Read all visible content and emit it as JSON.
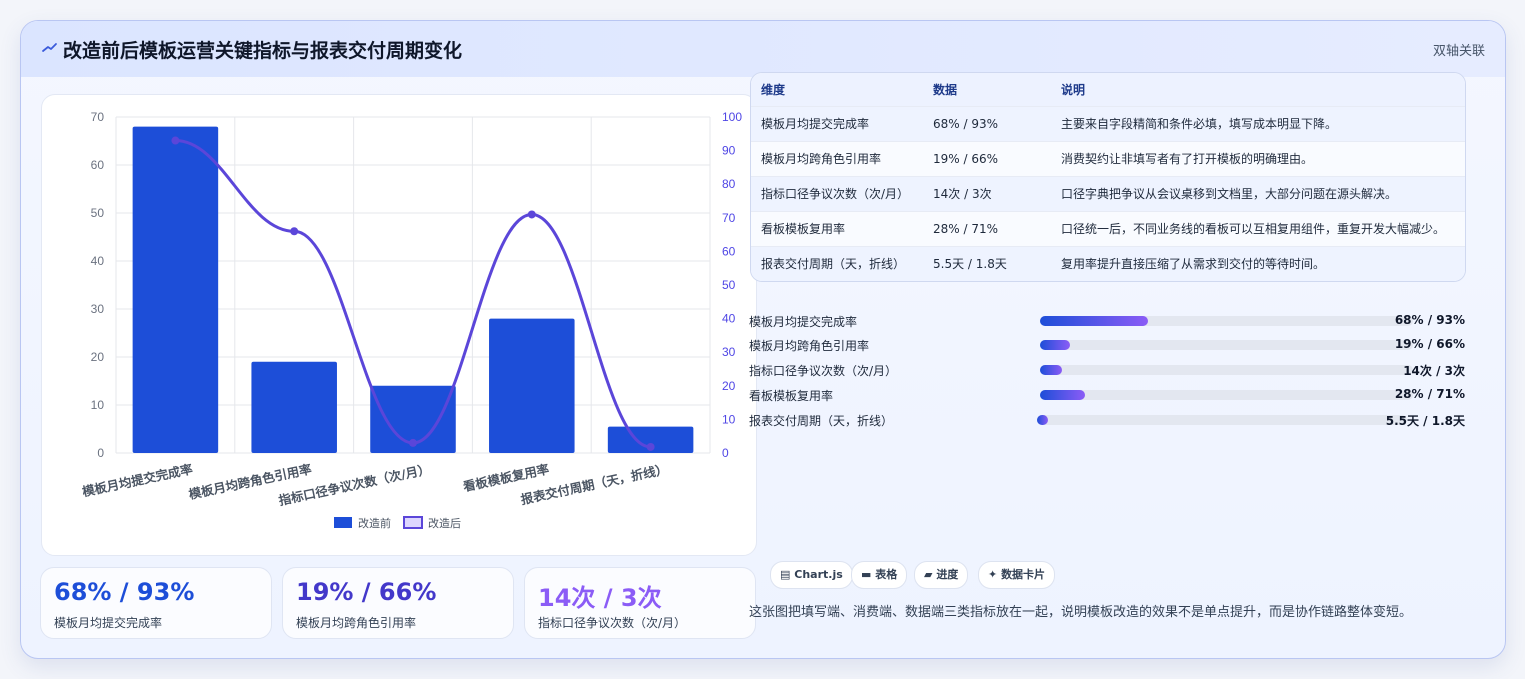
{
  "header": {
    "title": "改造前后模板运营关键指标与报表交付周期变化",
    "badge": "双轴关联",
    "icon": "trend-icon"
  },
  "chart_data": {
    "type": "bar",
    "categories": [
      "模板月均提交完成率",
      "模板月均跨角色引用率",
      "指标口径争议次数（次/月）",
      "看板模板复用率",
      "报表交付周期（天，折线）"
    ],
    "series": [
      {
        "name": "改造前",
        "type": "bar",
        "axis": "left",
        "values": [
          68,
          19,
          14,
          28,
          5.5
        ],
        "color": "#1d4ed8"
      },
      {
        "name": "改造后",
        "type": "line",
        "axis": "right",
        "values": [
          93,
          66,
          3,
          71,
          1.8
        ],
        "color": "#5b46d9"
      }
    ],
    "y_left": {
      "min": 0,
      "max": 70,
      "ticks": [
        0,
        10,
        20,
        30,
        40,
        50,
        60,
        70
      ]
    },
    "y_right": {
      "min": 0,
      "max": 100,
      "ticks": [
        0,
        10,
        20,
        30,
        40,
        50,
        60,
        70,
        80,
        90,
        100
      ]
    },
    "grid": true,
    "legend_position": "bottom"
  },
  "kpis": [
    {
      "value": "68% / 93%",
      "label": "模板月均提交完成率",
      "color": "#1d4ed8"
    },
    {
      "value": "19% / 66%",
      "label": "模板月均跨角色引用率",
      "color": "#4338ca"
    },
    {
      "value": "14次 / 3次",
      "label": "指标口径争议次数（次/月）",
      "color": "#8b5cf6"
    }
  ],
  "table": {
    "headers": [
      "维度",
      "数据",
      "说明"
    ],
    "rows": [
      {
        "dim": "模板月均提交完成率",
        "data": "68% / 93%",
        "desc": "主要来自字段精简和条件必填，填写成本明显下降。"
      },
      {
        "dim": "模板月均跨角色引用率",
        "data": "19% / 66%",
        "desc": "消费契约让非填写者有了打开模板的明确理由。"
      },
      {
        "dim": "指标口径争议次数（次/月）",
        "data": "14次 / 3次",
        "desc": "口径字典把争议从会议桌移到文档里，大部分问题在源头解决。"
      },
      {
        "dim": "看板模板复用率",
        "data": "28% / 71%",
        "desc": "口径统一后，不同业务线的看板可以互相复用组件，重复开发大幅减少。"
      },
      {
        "dim": "报表交付周期（天，折线）",
        "data": "5.5天 / 1.8天",
        "desc": "复用率提升直接压缩了从需求到交付的等待时间。"
      }
    ]
  },
  "progress": [
    {
      "label": "模板月均提交完成率",
      "value": "68% / 93%",
      "fill": 0.29
    },
    {
      "label": "模板月均跨角色引用率",
      "value": "19% / 66%",
      "fill": 0.08
    },
    {
      "label": "指标口径争议次数（次/月）",
      "value": "14次 / 3次",
      "fill": 0.06
    },
    {
      "label": "看板模板复用率",
      "value": "28% / 71%",
      "fill": 0.12
    },
    {
      "label": "报表交付周期（天，折线）",
      "value": "5.5天 / 1.8天",
      "fill": 0.03
    }
  ],
  "chips": [
    {
      "icon": "chart-icon",
      "label": "Chart.js"
    },
    {
      "icon": "table-icon",
      "label": "表格"
    },
    {
      "icon": "progress-icon",
      "label": "进度"
    },
    {
      "icon": "sparkle-icon",
      "label": "数据卡片"
    }
  ],
  "note": "这张图把填写端、消费端、数据端三类指标放在一起，说明模板改造的效果不是单点提升，而是协作链路整体变短。"
}
